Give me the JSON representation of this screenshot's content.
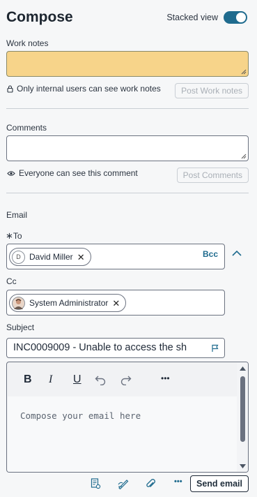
{
  "header": {
    "title": "Compose",
    "stacked_view_label": "Stacked view",
    "stacked_view_on": true
  },
  "work_notes": {
    "label": "Work notes",
    "value": "",
    "note": "Only internal users can see work notes",
    "post_label": "Post Work notes"
  },
  "comments": {
    "label": "Comments",
    "value": "",
    "note": "Everyone can see this comment",
    "post_label": "Post Comments"
  },
  "email": {
    "section_label": "Email",
    "to_label": "To",
    "required_marker": "∗",
    "to_recipients": [
      {
        "initial": "D",
        "name": "David Miller"
      }
    ],
    "bcc_label": "Bcc",
    "cc_label": "Cc",
    "cc_recipients": [
      {
        "name": "System Administrator"
      }
    ],
    "subject_label": "Subject",
    "subject_value": "INC0009009 - Unable to access the sh",
    "editor_placeholder": "Compose your email here",
    "toolbar": {
      "bold": "B",
      "italic": "I",
      "underline": "U",
      "more": "•••"
    }
  },
  "footer": {
    "more": "•••",
    "send_label": "Send email"
  },
  "colors": {
    "accent": "#1f6b8e",
    "work_notes_bg": "#f7d48a",
    "border": "#6b7280"
  }
}
